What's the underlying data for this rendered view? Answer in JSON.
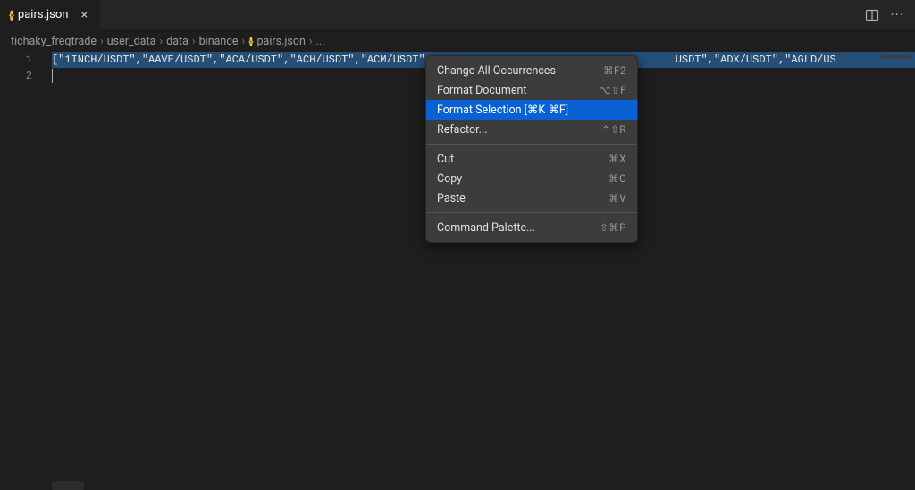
{
  "tab": {
    "title": "pairs.json"
  },
  "breadcrumb": {
    "items": [
      "tichaky_freqtrade",
      "user_data",
      "data",
      "binance"
    ],
    "file": "pairs.json",
    "ellipsis": "..."
  },
  "editor": {
    "line_numbers": [
      "1",
      "2"
    ],
    "line1_tokens": [
      {
        "t": "punct",
        "v": "["
      },
      {
        "t": "str",
        "v": "\"1INCH/USDT\""
      },
      {
        "t": "punct",
        "v": ","
      },
      {
        "t": "str",
        "v": "\"AAVE/USDT\""
      },
      {
        "t": "punct",
        "v": ","
      },
      {
        "t": "str",
        "v": "\"ACA/USDT\""
      },
      {
        "t": "punct",
        "v": ","
      },
      {
        "t": "str",
        "v": "\"ACH/USDT\""
      },
      {
        "t": "punct",
        "v": ","
      },
      {
        "t": "str",
        "v": "\"ACM/USDT\""
      }
    ],
    "line1_right_tokens": [
      {
        "t": "str",
        "v": "USDT\""
      },
      {
        "t": "punct",
        "v": ","
      },
      {
        "t": "str",
        "v": "\"ADX/USDT\""
      },
      {
        "t": "punct",
        "v": ","
      },
      {
        "t": "str",
        "v": "\"AGLD/US"
      }
    ]
  },
  "context_menu": {
    "groups": [
      [
        {
          "label": "Change All Occurrences",
          "shortcut": "⌘F2",
          "highlight": false
        },
        {
          "label": "Format Document",
          "shortcut": "⌥⇧F",
          "highlight": false
        },
        {
          "label": "Format Selection [⌘K ⌘F]",
          "shortcut": "",
          "highlight": true
        },
        {
          "label": "Refactor...",
          "shortcut": "⌃⇧R",
          "highlight": false
        }
      ],
      [
        {
          "label": "Cut",
          "shortcut": "⌘X",
          "highlight": false
        },
        {
          "label": "Copy",
          "shortcut": "⌘C",
          "highlight": false
        },
        {
          "label": "Paste",
          "shortcut": "⌘V",
          "highlight": false
        }
      ],
      [
        {
          "label": "Command Palette...",
          "shortcut": "⇧⌘P",
          "highlight": false
        }
      ]
    ]
  }
}
